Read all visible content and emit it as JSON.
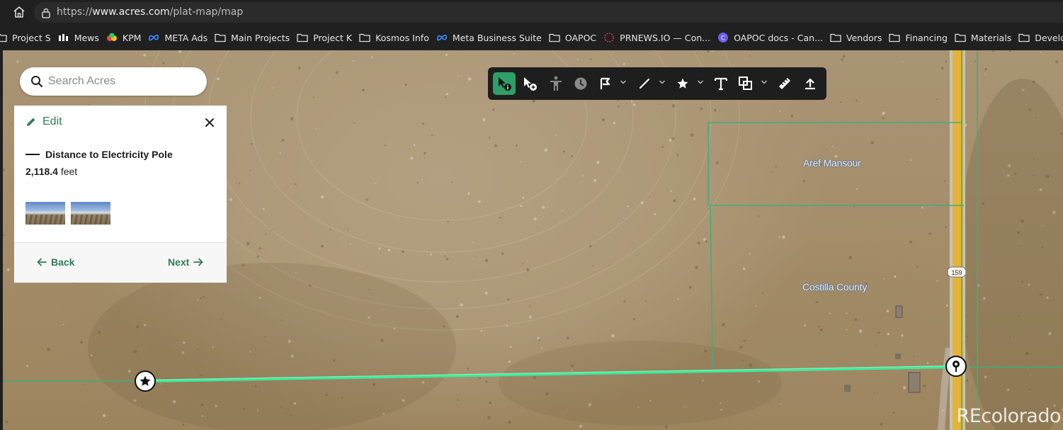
{
  "browser": {
    "url_prefix": "https://",
    "url_domain": "www.acres.com",
    "url_path": "/plat-map/map"
  },
  "bookmarks": [
    {
      "label": "Project S",
      "icon": "folder-icon"
    },
    {
      "label": "Mews",
      "icon": "mews-icon"
    },
    {
      "label": "KPM",
      "icon": "kpm-icon"
    },
    {
      "label": "META Ads",
      "icon": "meta-icon"
    },
    {
      "label": "Main Projects",
      "icon": "folder-icon"
    },
    {
      "label": "Project K",
      "icon": "folder-icon"
    },
    {
      "label": "Kosmos Info",
      "icon": "folder-icon"
    },
    {
      "label": "Meta Business Suite",
      "icon": "meta-icon"
    },
    {
      "label": "OAPOC",
      "icon": "folder-icon"
    },
    {
      "label": "PRNEWS.IO — Con...",
      "icon": "prnews-icon"
    },
    {
      "label": "OAPOC docs - Can...",
      "icon": "canva-icon"
    },
    {
      "label": "Vendors",
      "icon": "folder-icon"
    },
    {
      "label": "Financing",
      "icon": "folder-icon"
    },
    {
      "label": "Materials",
      "icon": "folder-icon"
    },
    {
      "label": "Developm",
      "icon": "folder-icon"
    }
  ],
  "search": {
    "placeholder": "Search Acres"
  },
  "panel": {
    "edit_label": "Edit",
    "measurement_title": "Distance to Electricity Pole",
    "measurement_value": "2,118.4",
    "measurement_unit": "feet",
    "back_label": "Back",
    "next_label": "Next"
  },
  "toolbar": {
    "tools": [
      "select-info-icon",
      "select-add-icon",
      "person-icon",
      "clock-icon",
      "parcel-flag-icon",
      "line-icon",
      "star-icon",
      "text-icon",
      "shapes-icon",
      "ruler-icon",
      "upload-icon"
    ],
    "active_color": "#2f9e67"
  },
  "map": {
    "parcel_labels": [
      "Aref Mansour",
      "Costilla County"
    ],
    "road_shield": "159",
    "watermark": "REcolorado",
    "measure_line_color": "#3ee89a",
    "parcel_line_color": "#3fae7c",
    "road_color": "#e3b33a"
  }
}
